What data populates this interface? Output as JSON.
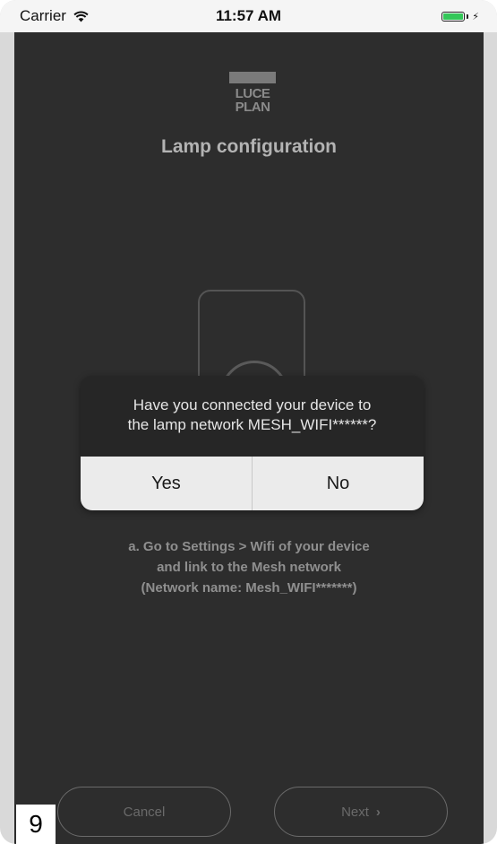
{
  "status_bar": {
    "carrier": "Carrier",
    "time": "11:57 AM"
  },
  "header": {
    "logo_line1": "LUCE",
    "logo_line2": "PLAN",
    "title": "Lamp configuration"
  },
  "dialog": {
    "message_line1": "Have you connected your device to",
    "message_line2": "the lamp network MESH_WIFI******?",
    "yes_label": "Yes",
    "no_label": "No"
  },
  "instructions": {
    "line1": "a. Go to Settings > Wifi of your device",
    "line2": "and link to the Mesh network",
    "line3": "(Network name: Mesh_WIFI*******)"
  },
  "footer": {
    "cancel_label": "Cancel",
    "next_label": "Next",
    "next_chevron": "›"
  },
  "page_number": "9"
}
